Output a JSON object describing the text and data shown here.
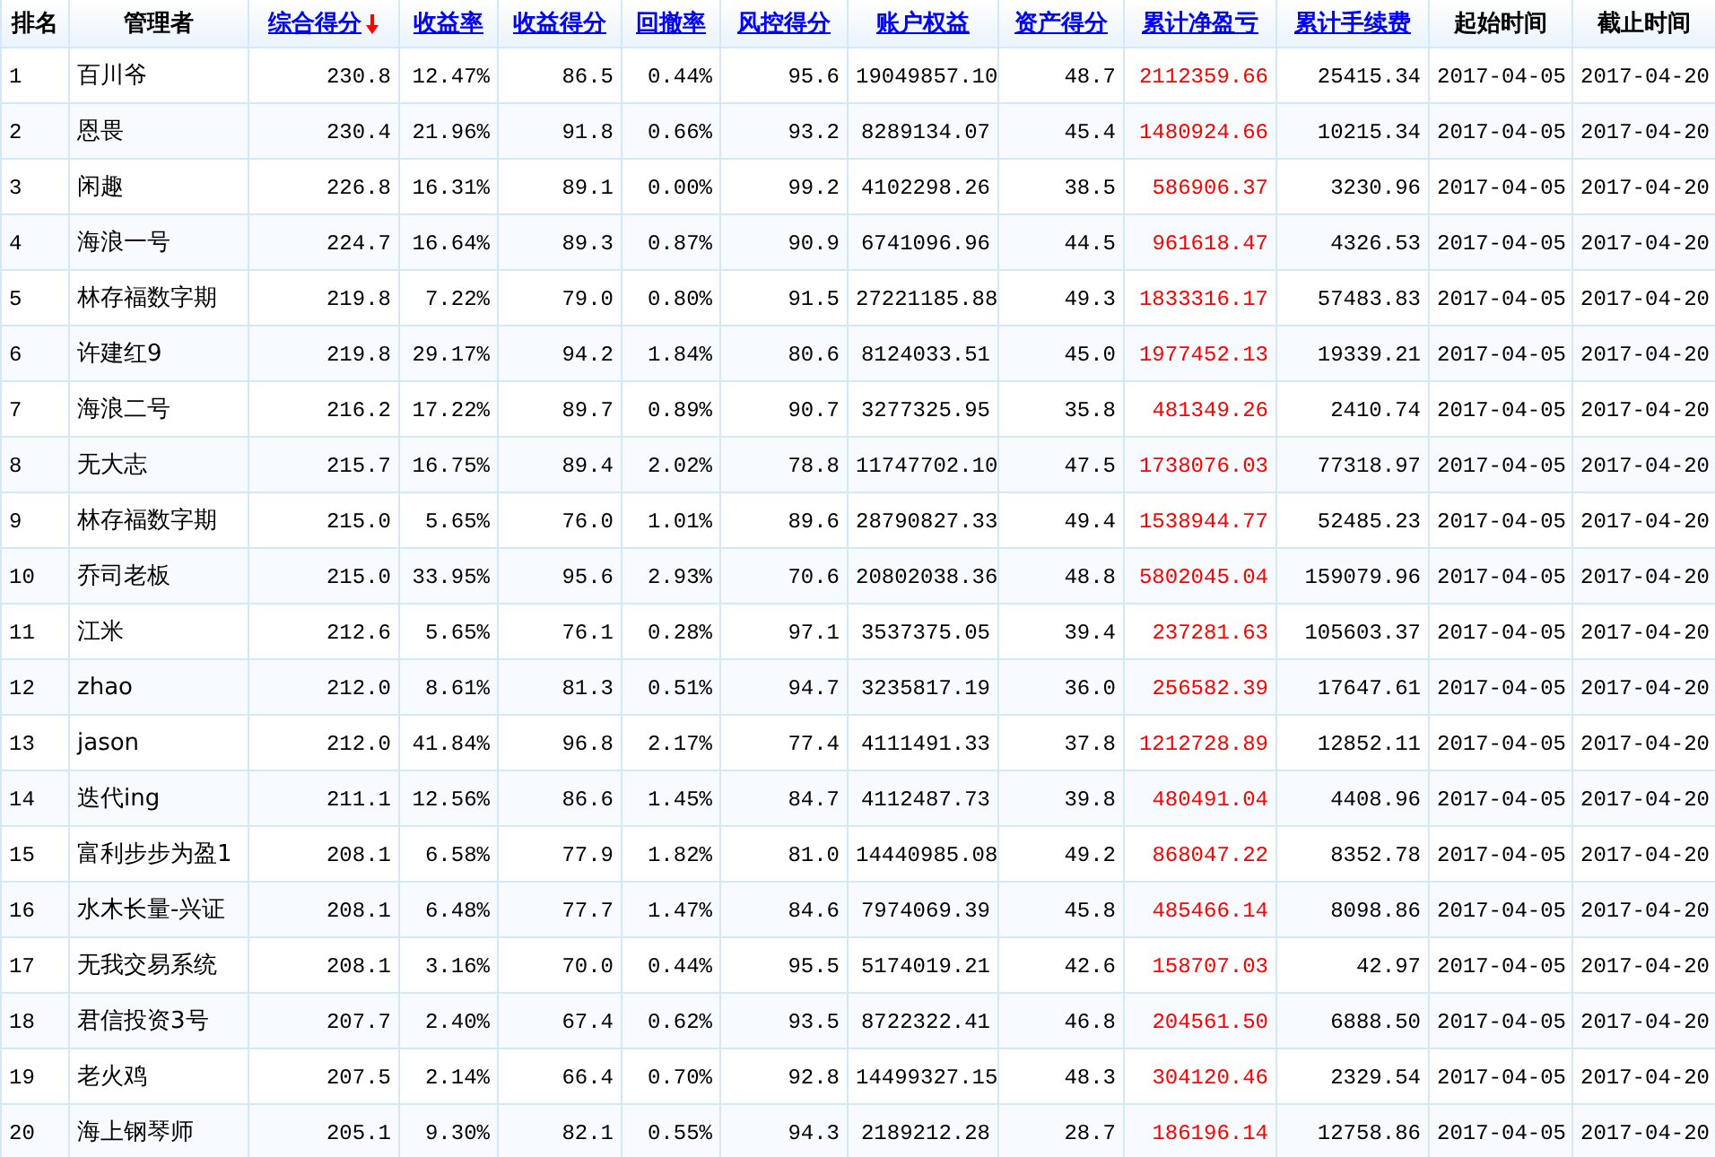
{
  "table": {
    "columns": [
      {
        "label": "排名",
        "kind": "plain",
        "sorted": false
      },
      {
        "label": "管理者",
        "kind": "plain",
        "sorted": false
      },
      {
        "label": "综合得分",
        "kind": "link",
        "sorted": true
      },
      {
        "label": "收益率",
        "kind": "link",
        "sorted": false
      },
      {
        "label": "收益得分",
        "kind": "link",
        "sorted": false
      },
      {
        "label": "回撤率",
        "kind": "link",
        "sorted": false
      },
      {
        "label": "风控得分",
        "kind": "link",
        "sorted": false
      },
      {
        "label": "账户权益",
        "kind": "link",
        "sorted": false
      },
      {
        "label": "资产得分",
        "kind": "link",
        "sorted": false
      },
      {
        "label": "累计净盈亏",
        "kind": "link",
        "sorted": false,
        "color": "#ff0000"
      },
      {
        "label": "累计手续费",
        "kind": "link",
        "sorted": false
      },
      {
        "label": "起始时间",
        "kind": "plain",
        "sorted": false
      },
      {
        "label": "截止时间",
        "kind": "plain",
        "sorted": false
      }
    ],
    "rows": [
      [
        "1",
        "百川爷",
        "230.8",
        "12.47%",
        "86.5",
        "0.44%",
        "95.6",
        "19049857.10",
        "48.7",
        "2112359.66",
        "25415.34",
        "2017-04-05",
        "2017-04-20"
      ],
      [
        "2",
        "恩畏",
        "230.4",
        "21.96%",
        "91.8",
        "0.66%",
        "93.2",
        "8289134.07",
        "45.4",
        "1480924.66",
        "10215.34",
        "2017-04-05",
        "2017-04-20"
      ],
      [
        "3",
        "闲趣",
        "226.8",
        "16.31%",
        "89.1",
        "0.00%",
        "99.2",
        "4102298.26",
        "38.5",
        "586906.37",
        "3230.96",
        "2017-04-05",
        "2017-04-20"
      ],
      [
        "4",
        "海浪一号",
        "224.7",
        "16.64%",
        "89.3",
        "0.87%",
        "90.9",
        "6741096.96",
        "44.5",
        "961618.47",
        "4326.53",
        "2017-04-05",
        "2017-04-20"
      ],
      [
        "5",
        "林存福数字期",
        "219.8",
        "7.22%",
        "79.0",
        "0.80%",
        "91.5",
        "27221185.88",
        "49.3",
        "1833316.17",
        "57483.83",
        "2017-04-05",
        "2017-04-20"
      ],
      [
        "6",
        "许建红9",
        "219.8",
        "29.17%",
        "94.2",
        "1.84%",
        "80.6",
        "8124033.51",
        "45.0",
        "1977452.13",
        "19339.21",
        "2017-04-05",
        "2017-04-20"
      ],
      [
        "7",
        "海浪二号",
        "216.2",
        "17.22%",
        "89.7",
        "0.89%",
        "90.7",
        "3277325.95",
        "35.8",
        "481349.26",
        "2410.74",
        "2017-04-05",
        "2017-04-20"
      ],
      [
        "8",
        "无大志",
        "215.7",
        "16.75%",
        "89.4",
        "2.02%",
        "78.8",
        "11747702.10",
        "47.5",
        "1738076.03",
        "77318.97",
        "2017-04-05",
        "2017-04-20"
      ],
      [
        "9",
        "林存福数字期",
        "215.0",
        "5.65%",
        "76.0",
        "1.01%",
        "89.6",
        "28790827.33",
        "49.4",
        "1538944.77",
        "52485.23",
        "2017-04-05",
        "2017-04-20"
      ],
      [
        "10",
        "乔司老板",
        "215.0",
        "33.95%",
        "95.6",
        "2.93%",
        "70.6",
        "20802038.36",
        "48.8",
        "5802045.04",
        "159079.96",
        "2017-04-05",
        "2017-04-20"
      ],
      [
        "11",
        "江米",
        "212.6",
        "5.65%",
        "76.1",
        "0.28%",
        "97.1",
        "3537375.05",
        "39.4",
        "237281.63",
        "105603.37",
        "2017-04-05",
        "2017-04-20"
      ],
      [
        "12",
        "zhao",
        "212.0",
        "8.61%",
        "81.3",
        "0.51%",
        "94.7",
        "3235817.19",
        "36.0",
        "256582.39",
        "17647.61",
        "2017-04-05",
        "2017-04-20"
      ],
      [
        "13",
        "jason",
        "212.0",
        "41.84%",
        "96.8",
        "2.17%",
        "77.4",
        "4111491.33",
        "37.8",
        "1212728.89",
        "12852.11",
        "2017-04-05",
        "2017-04-20"
      ],
      [
        "14",
        "迭代ing",
        "211.1",
        "12.56%",
        "86.6",
        "1.45%",
        "84.7",
        "4112487.73",
        "39.8",
        "480491.04",
        "4408.96",
        "2017-04-05",
        "2017-04-20"
      ],
      [
        "15",
        "富利步步为盈1",
        "208.1",
        "6.58%",
        "77.9",
        "1.82%",
        "81.0",
        "14440985.08",
        "49.2",
        "868047.22",
        "8352.78",
        "2017-04-05",
        "2017-04-20"
      ],
      [
        "16",
        "水木长量-兴证",
        "208.1",
        "6.48%",
        "77.7",
        "1.47%",
        "84.6",
        "7974069.39",
        "45.8",
        "485466.14",
        "8098.86",
        "2017-04-05",
        "2017-04-20"
      ],
      [
        "17",
        "无我交易系统",
        "208.1",
        "3.16%",
        "70.0",
        "0.44%",
        "95.5",
        "5174019.21",
        "42.6",
        "158707.03",
        "42.97",
        "2017-04-05",
        "2017-04-20"
      ],
      [
        "18",
        "君信投资3号",
        "207.7",
        "2.40%",
        "67.4",
        "0.62%",
        "93.5",
        "8722322.41",
        "46.8",
        "204561.50",
        "6888.50",
        "2017-04-05",
        "2017-04-20"
      ],
      [
        "19",
        "老火鸡",
        "207.5",
        "2.14%",
        "66.4",
        "0.70%",
        "92.8",
        "14499327.15",
        "48.3",
        "304120.46",
        "2329.54",
        "2017-04-05",
        "2017-04-20"
      ],
      [
        "20",
        "海上钢琴师",
        "205.1",
        "9.30%",
        "82.1",
        "0.55%",
        "94.3",
        "2189212.28",
        "28.7",
        "186196.14",
        "12758.86",
        "2017-04-05",
        "2017-04-20"
      ]
    ]
  }
}
